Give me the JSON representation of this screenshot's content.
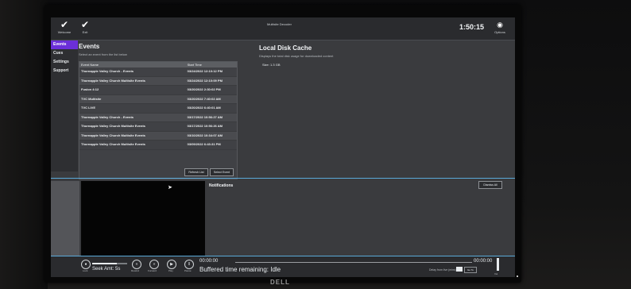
{
  "topbar": {
    "welcome": {
      "label": "Welcome",
      "icon": "check-icon"
    },
    "exit": {
      "label": "Exit",
      "icon": "check-icon"
    },
    "window_title": "Multisite Decoder",
    "clock": "1:50:15",
    "options": {
      "label": "Options",
      "icon": "gear-icon"
    }
  },
  "nav": {
    "items": [
      {
        "label": "Events",
        "active": true
      },
      {
        "label": "Cues",
        "active": false
      },
      {
        "label": "Settings",
        "active": false
      },
      {
        "label": "Support",
        "active": false
      }
    ]
  },
  "events": {
    "title": "Events",
    "subtitle": "Select an event from the list below",
    "columns": [
      "Event Name",
      "Start Time"
    ],
    "rows": [
      [
        "Thornapple Valley Church - Events",
        "03/24/2022 12:10:12 PM"
      ],
      [
        "Thornapple Valley Church Multisite Events",
        "03/24/2022 12:10:09 PM"
      ],
      [
        "Fusion 4:12",
        "03/20/2022 2:30:02 PM"
      ],
      [
        "TVC Multisite",
        "03/20/2022 7:40:02 AM"
      ],
      [
        "TVC LIVE",
        "03/20/2022 6:40:01 AM"
      ],
      [
        "Thornapple Valley Church - Events",
        "03/17/2022 10:56:27 AM"
      ],
      [
        "Thornapple Valley Church Multisite Events",
        "03/17/2022 10:56:26 AM"
      ],
      [
        "Thornapple Valley Church Multisite Events",
        "03/10/2022 10:34:07 AM"
      ],
      [
        "Thornapple Valley Church Multisite Events",
        "03/09/2022 6:43:31 PM"
      ]
    ],
    "refresh_label": "Refresh List",
    "select_label": "Select Event"
  },
  "cache": {
    "title": "Local Disk Cache",
    "subtitle": "Displays the total disk usage for downloaded content",
    "size_label": "Size:",
    "size_value": "1.3 GB"
  },
  "notifications": {
    "title": "Notifications",
    "dismiss_label": "Dismiss All"
  },
  "player": {
    "seek_text": "Seek Amt: 5s",
    "buttons": [
      {
        "label": "Lock",
        "icon": "lock-icon"
      },
      {
        "label": "Rewind",
        "icon": "rewind-icon"
      },
      {
        "label": "Forward",
        "icon": "forward-icon"
      },
      {
        "label": "Play",
        "icon": "play-icon"
      },
      {
        "label": "Pause",
        "icon": "pause-icon"
      }
    ],
    "time_left": "00:00:00",
    "time_right": "00:00:00",
    "buffered": "Buffered time remaining: Idle",
    "delay_label": "Delay from live (mins):",
    "goto_label": "Go To",
    "volume_label": "Vol"
  },
  "bezel": {
    "brand": "DELL"
  }
}
